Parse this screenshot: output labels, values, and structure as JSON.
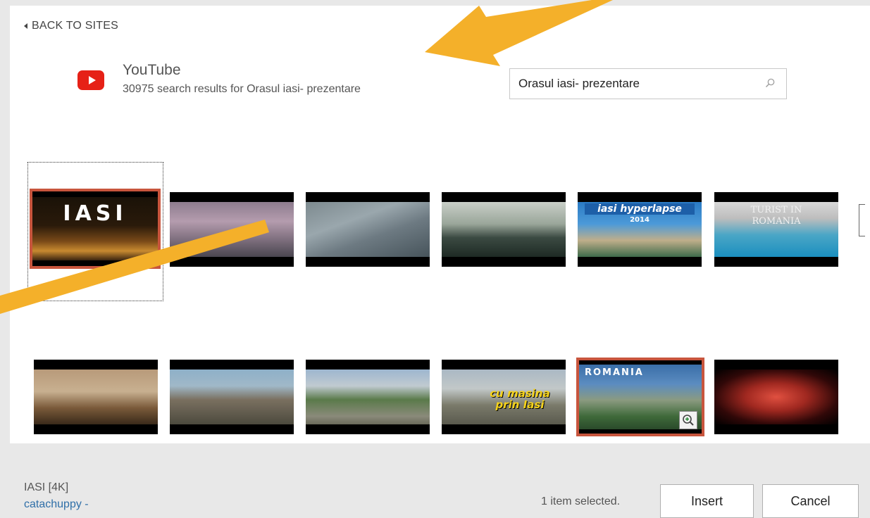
{
  "nav": {
    "back_label": "BACK TO SITES"
  },
  "site": {
    "name": "YouTube",
    "result_count": "30975",
    "results_text": "30975 search results for Orasul iasi- prezentare"
  },
  "search": {
    "value": "Orasul iasi- prezentare",
    "placeholder": ""
  },
  "thumbnails": [
    {
      "title_text": "IASI",
      "selected": true
    },
    {
      "title_text": ""
    },
    {
      "title_text": ""
    },
    {
      "title_text": ""
    },
    {
      "title_text": "iasi hyperlapse",
      "subtitle_text": "2014"
    },
    {
      "title_text": "TURIST IN ROMANIA"
    },
    {
      "title_text": ""
    },
    {
      "title_text": ""
    },
    {
      "title_text": ""
    },
    {
      "title_text": "cu masina prin Iasi"
    },
    {
      "title_text": "ROMANIA",
      "hovered": true
    },
    {
      "title_text": ""
    }
  ],
  "footer": {
    "selected_title": "IASI [4K]",
    "selected_author": "catachuppy -",
    "status": "1 item selected.",
    "insert_label": "Insert",
    "cancel_label": "Cancel"
  },
  "colors": {
    "youtube_red": "#e62117",
    "selection_border": "#c8553d",
    "annotation_arrow": "#f4b02a",
    "link_blue": "#2f6fa8"
  },
  "icons": [
    "youtube-logo-icon",
    "search-icon",
    "zoom-in-icon",
    "chevron-left-icon"
  ]
}
